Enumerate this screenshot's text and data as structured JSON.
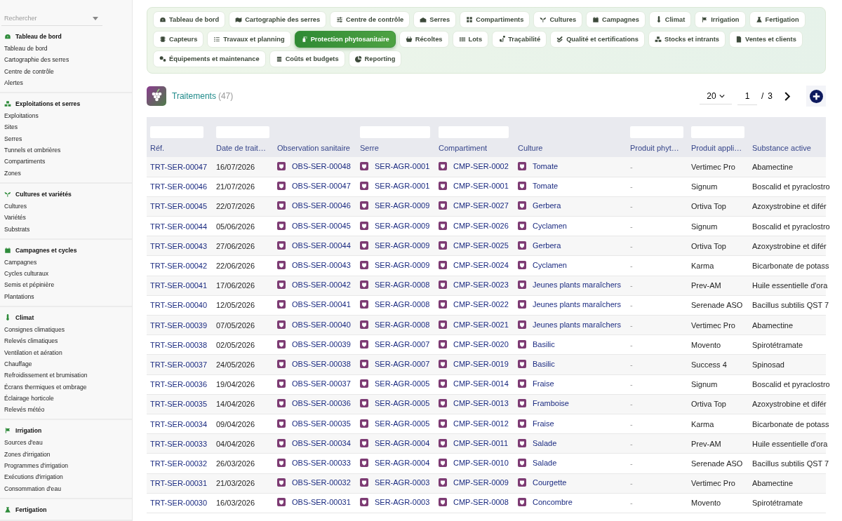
{
  "sidebar": {
    "search": {
      "placeholder": "Rechercher"
    },
    "sections": [
      {
        "title": "Tableau de bord",
        "items": [
          "Tableau de bord",
          "Cartographie des serres",
          "Centre de contrôle",
          "Alertes"
        ]
      },
      {
        "title": "Exploitations et serres",
        "items": [
          "Exploitations",
          "Sites",
          "Serres",
          "Tunnels et ombrières",
          "Compartiments",
          "Zones"
        ]
      },
      {
        "title": "Cultures et variétés",
        "items": [
          "Cultures",
          "Variétés",
          "Substrats"
        ]
      },
      {
        "title": "Campagnes et cycles",
        "items": [
          "Campagnes",
          "Cycles culturaux",
          "Semis et pépinière",
          "Plantations"
        ]
      },
      {
        "title": "Climat",
        "items": [
          "Consignes climatiques",
          "Relevés climatiques",
          "Ventilation et aération",
          "Chauffage",
          "Refroidissement et brumisation",
          "Écrans thermiques et ombrage",
          "Éclairage horticole",
          "Relevés météo"
        ]
      },
      {
        "title": "Irrigation",
        "items": [
          "Sources d'eau",
          "Zones d'irrigation",
          "Programmes d'irrigation",
          "Exécutions d'irrigation",
          "Consommation d'eau"
        ]
      },
      {
        "title": "Fertigation"
      }
    ]
  },
  "nav_tabs": [
    {
      "label": "Tableau de bord",
      "selected": false
    },
    {
      "label": "Cartographie des serres",
      "selected": false
    },
    {
      "label": "Centre de contrôle",
      "selected": false
    },
    {
      "label": "Serres",
      "selected": false
    },
    {
      "label": "Compartiments",
      "selected": false
    },
    {
      "label": "Cultures",
      "selected": false
    },
    {
      "label": "Campagnes",
      "selected": false
    },
    {
      "label": "Climat",
      "selected": false
    },
    {
      "label": "Irrigation",
      "selected": false
    },
    {
      "label": "Fertigation",
      "selected": false
    },
    {
      "label": "Capteurs",
      "selected": false
    },
    {
      "label": "Travaux et planning",
      "selected": false
    },
    {
      "label": "Protection phytosanitaire",
      "selected": true
    },
    {
      "label": "Récoltes",
      "selected": false
    },
    {
      "label": "Lots",
      "selected": false
    },
    {
      "label": "Traçabilité",
      "selected": false
    },
    {
      "label": "Qualité et certifications",
      "selected": false
    },
    {
      "label": "Stocks et intrants",
      "selected": false
    },
    {
      "label": "Ventes et clients",
      "selected": false
    },
    {
      "label": "Équipements et maintenance",
      "selected": false
    },
    {
      "label": "Coûts et budgets",
      "selected": false
    },
    {
      "label": "Reporting",
      "selected": false
    }
  ],
  "header": {
    "title": "Traitements",
    "count": "(47)",
    "page_size": "20",
    "page": "1",
    "separator": "/",
    "page_count": "3"
  },
  "table": {
    "columns": [
      {
        "label": "Réf.",
        "kind": "ref",
        "filter": true
      },
      {
        "label": "Date de trait…",
        "kind": "text",
        "filter": true
      },
      {
        "label": "Observation sanitaire",
        "kind": "linked",
        "filter": false
      },
      {
        "label": "Serre",
        "kind": "linked",
        "filter": true
      },
      {
        "label": "Compartiment",
        "kind": "linked",
        "filter": true
      },
      {
        "label": "Culture",
        "kind": "linked",
        "filter": false
      },
      {
        "label": "Produit phyt…",
        "kind": "muted",
        "filter": true
      },
      {
        "label": "Produit appli…",
        "kind": "text",
        "filter": true
      },
      {
        "label": "Substance active",
        "kind": "text",
        "filter": false
      }
    ],
    "rows": [
      {
        "cells": [
          "TRT-SER-00047",
          "16/07/2026",
          "OBS-SER-00048",
          "SER-AGR-0001",
          "CMP-SER-0002",
          "Tomate",
          "-",
          "Vertimec Pro",
          "Abamectine"
        ]
      },
      {
        "cells": [
          "TRT-SER-00046",
          "21/07/2026",
          "OBS-SER-00047",
          "SER-AGR-0001",
          "CMP-SER-0001",
          "Tomate",
          "-",
          "Signum",
          "Boscalid et pyraclostro"
        ]
      },
      {
        "cells": [
          "TRT-SER-00045",
          "22/07/2026",
          "OBS-SER-00046",
          "SER-AGR-0009",
          "CMP-SER-0027",
          "Gerbera",
          "-",
          "Ortiva Top",
          "Azoxystrobine et difér"
        ]
      },
      {
        "cells": [
          "TRT-SER-00044",
          "05/06/2026",
          "OBS-SER-00045",
          "SER-AGR-0009",
          "CMP-SER-0026",
          "Cyclamen",
          "-",
          "Signum",
          "Boscalid et pyraclostro"
        ]
      },
      {
        "cells": [
          "TRT-SER-00043",
          "27/06/2026",
          "OBS-SER-00044",
          "SER-AGR-0009",
          "CMP-SER-0025",
          "Gerbera",
          "-",
          "Ortiva Top",
          "Azoxystrobine et difér"
        ]
      },
      {
        "cells": [
          "TRT-SER-00042",
          "22/06/2026",
          "OBS-SER-00043",
          "SER-AGR-0009",
          "CMP-SER-0024",
          "Cyclamen",
          "-",
          "Karma",
          "Bicarbonate de potass"
        ]
      },
      {
        "cells": [
          "TRT-SER-00041",
          "17/06/2026",
          "OBS-SER-00042",
          "SER-AGR-0008",
          "CMP-SER-0023",
          "Jeunes plants maraîchers",
          "-",
          "Prev-AM",
          "Huile essentielle d'ora"
        ]
      },
      {
        "cells": [
          "TRT-SER-00040",
          "12/05/2026",
          "OBS-SER-00041",
          "SER-AGR-0008",
          "CMP-SER-0022",
          "Jeunes plants maraîchers",
          "-",
          "Serenade ASO",
          "Bacillus subtilis QST 7"
        ]
      },
      {
        "cells": [
          "TRT-SER-00039",
          "07/05/2026",
          "OBS-SER-00040",
          "SER-AGR-0008",
          "CMP-SER-0021",
          "Jeunes plants maraîchers",
          "-",
          "Vertimec Pro",
          "Abamectine"
        ]
      },
      {
        "cells": [
          "TRT-SER-00038",
          "02/05/2026",
          "OBS-SER-00039",
          "SER-AGR-0007",
          "CMP-SER-0020",
          "Basilic",
          "-",
          "Movento",
          "Spirotétramate"
        ]
      },
      {
        "cells": [
          "TRT-SER-00037",
          "24/05/2026",
          "OBS-SER-00038",
          "SER-AGR-0007",
          "CMP-SER-0019",
          "Basilic",
          "-",
          "Success 4",
          "Spinosad"
        ]
      },
      {
        "cells": [
          "TRT-SER-00036",
          "19/04/2026",
          "OBS-SER-00037",
          "SER-AGR-0005",
          "CMP-SER-0014",
          "Fraise",
          "-",
          "Signum",
          "Boscalid et pyraclostro"
        ]
      },
      {
        "cells": [
          "TRT-SER-00035",
          "14/04/2026",
          "OBS-SER-00036",
          "SER-AGR-0005",
          "CMP-SER-0013",
          "Framboise",
          "-",
          "Ortiva Top",
          "Azoxystrobine et difér"
        ]
      },
      {
        "cells": [
          "TRT-SER-00034",
          "09/04/2026",
          "OBS-SER-00035",
          "SER-AGR-0005",
          "CMP-SER-0012",
          "Fraise",
          "-",
          "Karma",
          "Bicarbonate de potass"
        ]
      },
      {
        "cells": [
          "TRT-SER-00033",
          "04/04/2026",
          "OBS-SER-00034",
          "SER-AGR-0004",
          "CMP-SER-0011",
          "Salade",
          "-",
          "Prev-AM",
          "Huile essentielle d'ora"
        ]
      },
      {
        "cells": [
          "TRT-SER-00032",
          "26/03/2026",
          "OBS-SER-00033",
          "SER-AGR-0004",
          "CMP-SER-0010",
          "Salade",
          "-",
          "Serenade ASO",
          "Bacillus subtilis QST 7"
        ]
      },
      {
        "cells": [
          "TRT-SER-00031",
          "21/03/2026",
          "OBS-SER-00032",
          "SER-AGR-0003",
          "CMP-SER-0009",
          "Courgette",
          "-",
          "Vertimec Pro",
          "Abamectine"
        ]
      },
      {
        "cells": [
          "TRT-SER-00030",
          "16/03/2026",
          "OBS-SER-00031",
          "SER-AGR-0003",
          "CMP-SER-0008",
          "Concombre",
          "-",
          "Movento",
          "Spirotétramate"
        ]
      }
    ]
  }
}
